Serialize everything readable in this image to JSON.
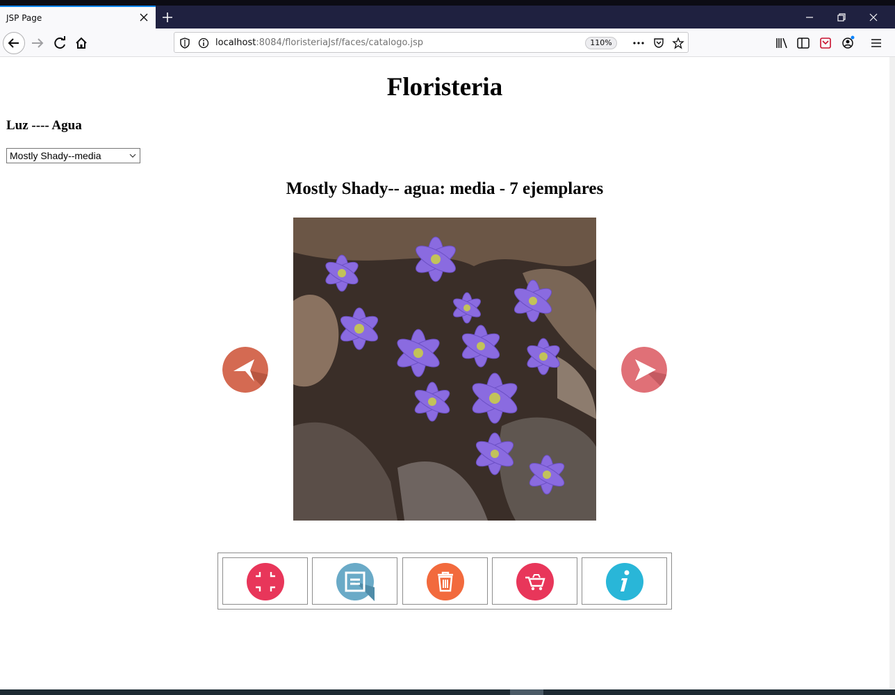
{
  "browser": {
    "tab_title": "JSP Page",
    "url_host": "localhost",
    "url_rest": ":8084/floristeriaJsf/faces/catalogo.jsp",
    "zoom": "110%",
    "accent_color": "#0a84ff"
  },
  "page": {
    "title": "Floristeria",
    "filter_label": "Luz ---- Agua",
    "select_value": "Mostly Shady--media",
    "section_title": "Mostly Shady-- agua: media - 7 ejemplares"
  },
  "carousel": {
    "prev_icon": "arrow-left-icon",
    "next_icon": "arrow-right-icon",
    "image": "purple-flowers-photo"
  },
  "toolbar": {
    "buttons": [
      {
        "icon": "collapse-icon",
        "color": "#e8365a"
      },
      {
        "icon": "document-icon",
        "color": "#6aaac7"
      },
      {
        "icon": "trash-icon",
        "color": "#f26a3d"
      },
      {
        "icon": "cart-icon",
        "color": "#e8365a"
      },
      {
        "icon": "info-icon",
        "color": "#29b6d8"
      }
    ]
  }
}
